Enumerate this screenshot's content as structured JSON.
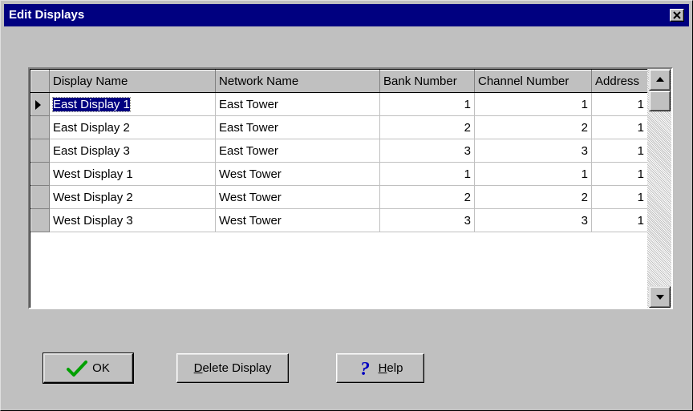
{
  "window": {
    "title": "Edit Displays",
    "close_label": "✕"
  },
  "grid": {
    "columns": [
      "Display Name",
      "Network Name",
      "Bank Number",
      "Channel Number",
      "Address"
    ],
    "rows": [
      {
        "display_name": "East Display 1",
        "network_name": "East Tower",
        "bank": "1",
        "channel": "1",
        "address": "1"
      },
      {
        "display_name": "East Display 2",
        "network_name": "East Tower",
        "bank": "2",
        "channel": "2",
        "address": "1"
      },
      {
        "display_name": "East Display 3",
        "network_name": "East Tower",
        "bank": "3",
        "channel": "3",
        "address": "1"
      },
      {
        "display_name": "West Display 1",
        "network_name": "West Tower",
        "bank": "1",
        "channel": "1",
        "address": "1"
      },
      {
        "display_name": "West Display 2",
        "network_name": "West Tower",
        "bank": "2",
        "channel": "2",
        "address": "1"
      },
      {
        "display_name": "West Display 3",
        "network_name": "West Tower",
        "bank": "3",
        "channel": "3",
        "address": "1"
      }
    ]
  },
  "buttons": {
    "ok_label": "OK",
    "delete_accel": "D",
    "delete_rest": "elete Display",
    "help_accel": "H",
    "help_rest": "elp"
  },
  "colors": {
    "titlebar": "#000080",
    "face": "#c0c0c0",
    "ok_check": "#00a000",
    "help_icon": "#0000c0"
  },
  "icons": {
    "ok": "check-icon",
    "help": "question-icon",
    "close": "close-icon",
    "row_indicator": "arrow-right-icon"
  }
}
